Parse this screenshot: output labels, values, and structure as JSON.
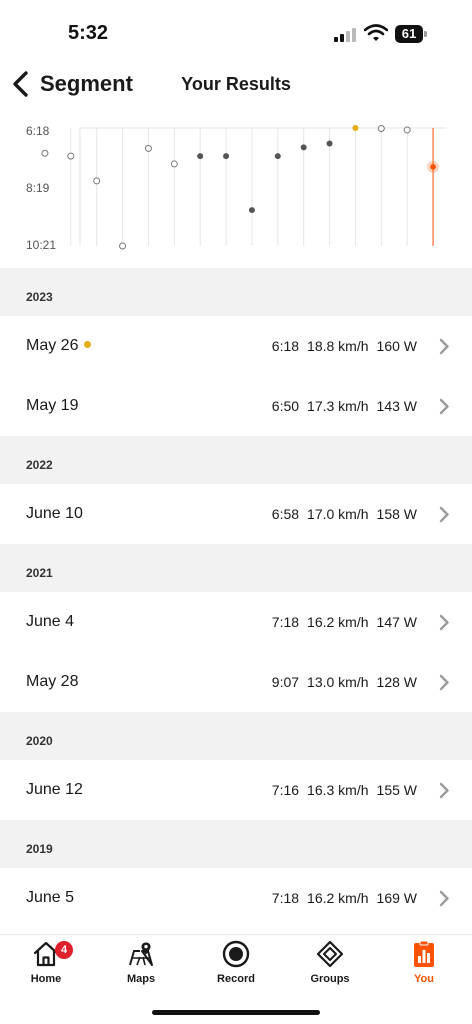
{
  "status_bar": {
    "time": "5:32",
    "battery": "61"
  },
  "header": {
    "back_label": "Segment",
    "title": "Your Results"
  },
  "chart_data": {
    "type": "scatter",
    "title": "",
    "xlabel": "",
    "ylabel": "",
    "y_ticks": [
      "6:18",
      "8:19",
      "10:21"
    ],
    "ylim_seconds": [
      378,
      621
    ],
    "y_inverted": true,
    "colors": {
      "pr": "#e6ad19",
      "selected": "#fc5200",
      "filled": "#555555",
      "hollow": "#777777",
      "grid": "#e6e6e6"
    },
    "points": [
      {
        "time_seconds": 430,
        "style": "hollow"
      },
      {
        "time_seconds": 436,
        "style": "hollow"
      },
      {
        "time_seconds": 487,
        "style": "hollow"
      },
      {
        "time_seconds": 621,
        "style": "hollow"
      },
      {
        "time_seconds": 420,
        "style": "hollow"
      },
      {
        "time_seconds": 452,
        "style": "hollow"
      },
      {
        "time_seconds": 436,
        "style": "filled"
      },
      {
        "time_seconds": 436,
        "style": "filled"
      },
      {
        "time_seconds": 547,
        "style": "filled"
      },
      {
        "time_seconds": 436,
        "style": "filled"
      },
      {
        "time_seconds": 418,
        "style": "filled"
      },
      {
        "time_seconds": 410,
        "style": "filled"
      },
      {
        "time_seconds": 378,
        "style": "pr"
      },
      {
        "time_seconds": 379,
        "style": "hollow"
      },
      {
        "time_seconds": 382,
        "style": "hollow"
      },
      {
        "time_seconds": 458,
        "style": "selected"
      }
    ]
  },
  "years": [
    {
      "year": "2023",
      "efforts": [
        {
          "date": "May 26",
          "pr": true,
          "time": "6:18",
          "speed": "18.8 km/h",
          "power": "160 W"
        },
        {
          "date": "May 19",
          "pr": false,
          "time": "6:50",
          "speed": "17.3 km/h",
          "power": "143 W"
        }
      ]
    },
    {
      "year": "2022",
      "efforts": [
        {
          "date": "June 10",
          "pr": false,
          "time": "6:58",
          "speed": "17.0 km/h",
          "power": "158 W"
        }
      ]
    },
    {
      "year": "2021",
      "efforts": [
        {
          "date": "June 4",
          "pr": false,
          "time": "7:18",
          "speed": "16.2 km/h",
          "power": "147 W"
        },
        {
          "date": "May 28",
          "pr": false,
          "time": "9:07",
          "speed": "13.0 km/h",
          "power": "128 W"
        }
      ]
    },
    {
      "year": "2020",
      "efforts": [
        {
          "date": "June 12",
          "pr": false,
          "time": "7:16",
          "speed": "16.3 km/h",
          "power": "155 W"
        }
      ]
    },
    {
      "year": "2019",
      "efforts": [
        {
          "date": "June 5",
          "pr": false,
          "time": "7:18",
          "speed": "16.2 km/h",
          "power": "169 W"
        }
      ]
    }
  ],
  "tabs": [
    {
      "label": "Home",
      "icon": "home-icon",
      "badge": "4",
      "active": false
    },
    {
      "label": "Maps",
      "icon": "maps-icon",
      "active": false
    },
    {
      "label": "Record",
      "icon": "record-icon",
      "active": false
    },
    {
      "label": "Groups",
      "icon": "groups-icon",
      "active": false
    },
    {
      "label": "You",
      "icon": "you-icon",
      "active": true
    }
  ]
}
